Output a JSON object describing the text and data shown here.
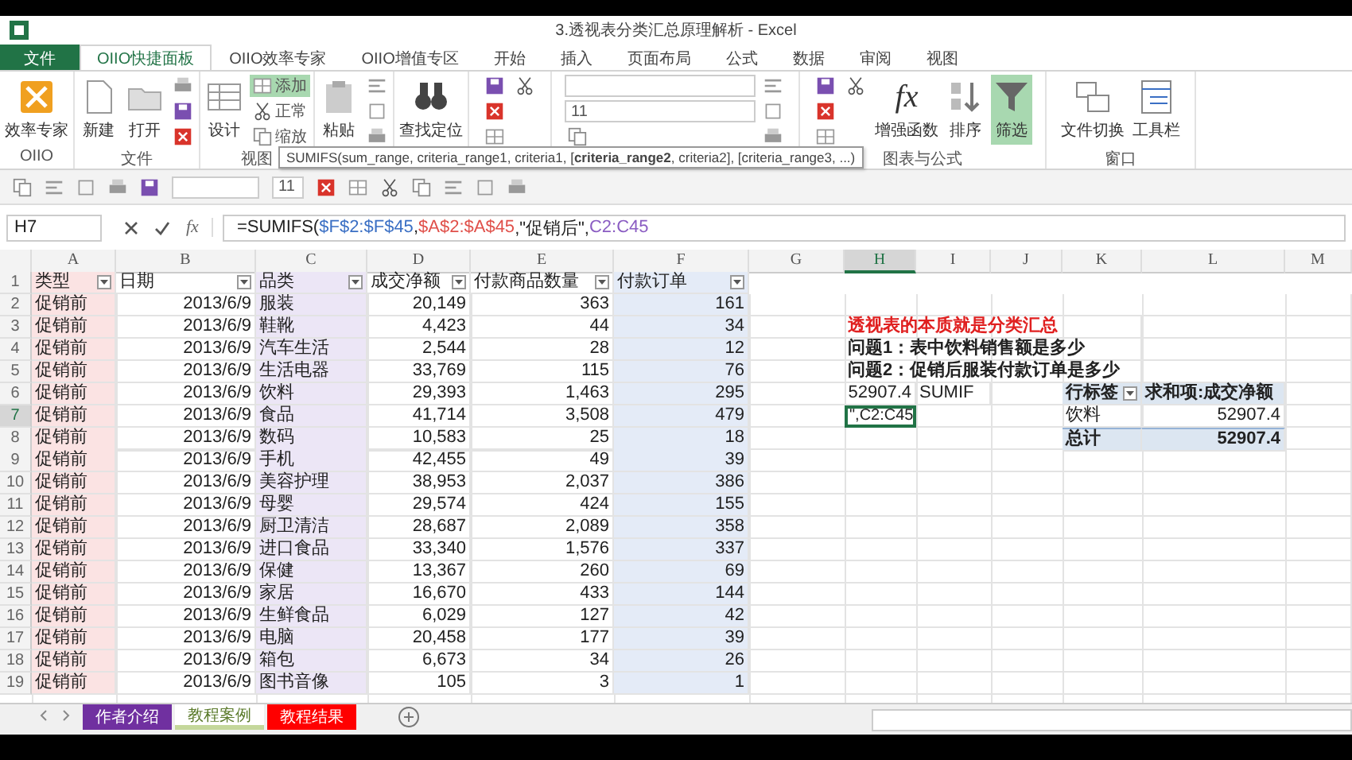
{
  "window": {
    "title": "3.透视表分类汇总原理解析 - Excel"
  },
  "ribbon_tabs": [
    {
      "label": "文件",
      "kind": "file",
      "selected": false
    },
    {
      "label": "OIIO快捷面板",
      "kind": "tab",
      "selected": true
    },
    {
      "label": "OIIO效率专家",
      "kind": "tab",
      "selected": false
    },
    {
      "label": "OIIO增值专区",
      "kind": "tab",
      "selected": false
    },
    {
      "label": "开始",
      "kind": "tab",
      "selected": false
    },
    {
      "label": "插入",
      "kind": "tab",
      "selected": false
    },
    {
      "label": "页面布局",
      "kind": "tab",
      "selected": false
    },
    {
      "label": "公式",
      "kind": "tab",
      "selected": false
    },
    {
      "label": "数据",
      "kind": "tab",
      "selected": false
    },
    {
      "label": "审阅",
      "kind": "tab",
      "selected": false
    },
    {
      "label": "视图",
      "kind": "tab",
      "selected": false
    }
  ],
  "ribbon_groups": [
    {
      "label": "OIIO",
      "items": [
        {
          "kind": "large",
          "label": "效率专家",
          "selected": false
        }
      ]
    },
    {
      "label": "文件",
      "items": [
        {
          "kind": "large",
          "label": "新建",
          "selected": false
        },
        {
          "kind": "large",
          "label": "打开",
          "selected": false
        },
        {
          "kind": "small",
          "selected": false
        },
        {
          "kind": "small",
          "selected": false
        },
        {
          "kind": "small",
          "selected": false
        }
      ]
    },
    {
      "label": "视图",
      "items": [
        {
          "kind": "large",
          "label": "设计",
          "selected": false
        },
        {
          "kind": "small",
          "label": "添加",
          "selected": true
        },
        {
          "kind": "small",
          "label": "正常",
          "selected": false
        },
        {
          "kind": "small",
          "label": "缩放",
          "selected": false
        }
      ]
    },
    {
      "items": [
        {
          "kind": "large",
          "label": "粘贴",
          "selected": false
        },
        {
          "kind": "small",
          "selected": false
        },
        {
          "kind": "small",
          "selected": false
        },
        {
          "kind": "small",
          "selected": false
        }
      ]
    },
    {
      "items": [
        {
          "kind": "large",
          "label": "查找定位",
          "selected": false
        }
      ]
    },
    {
      "items": [
        {
          "kind": "small",
          "selected": false
        },
        {
          "kind": "small",
          "selected": false
        },
        {
          "kind": "small",
          "selected": false
        },
        {
          "kind": "small",
          "selected": false
        }
      ]
    },
    {
      "items": [
        {
          "kind": "field"
        },
        {
          "kind": "field",
          "value": "11"
        },
        {
          "kind": "small",
          "selected": false
        },
        {
          "kind": "small",
          "selected": false
        },
        {
          "kind": "small",
          "selected": false
        },
        {
          "kind": "small",
          "selected": false
        }
      ]
    },
    {
      "label": "图表与公式",
      "items": [
        {
          "kind": "small",
          "selected": false
        },
        {
          "kind": "small",
          "selected": false
        },
        {
          "kind": "small",
          "selected": false
        },
        {
          "kind": "small",
          "selected": false
        },
        {
          "kind": "large",
          "label": "增强函数",
          "glyph": "fx",
          "selected": false
        },
        {
          "kind": "large",
          "label": "排序",
          "selected": false
        },
        {
          "kind": "large",
          "label": "筛选",
          "selected": true
        }
      ]
    },
    {
      "label": "窗口",
      "items": [
        {
          "kind": "large",
          "label": "文件切换",
          "selected": false
        },
        {
          "kind": "large",
          "label": "工具栏",
          "selected": false
        }
      ]
    }
  ],
  "tooltip": "SUMIFS(sum_range, criteria_range1, criteria1, [**criteria_range2**, criteria2], [criteria_range3, ...)",
  "quick_access": [
    {
      "kind": "icon"
    },
    {
      "kind": "icon"
    },
    {
      "kind": "icon"
    },
    {
      "kind": "icon"
    },
    {
      "kind": "icon"
    },
    {
      "kind": "field"
    },
    {
      "kind": "field",
      "value": "11"
    },
    {
      "kind": "icon"
    },
    {
      "kind": "icon"
    },
    {
      "kind": "icon"
    },
    {
      "kind": "icon"
    },
    {
      "kind": "icon"
    },
    {
      "kind": "icon"
    },
    {
      "kind": "icon"
    }
  ],
  "formula_bar": {
    "name_box": "H7",
    "fx": "fx",
    "parts": [
      {
        "text": "=SUMIFS(",
        "color": "#222222"
      },
      {
        "text": "$F$2:$F$45",
        "color": "#3a6fc4"
      },
      {
        "text": ",",
        "color": "#222222"
      },
      {
        "text": "$A$2:$A$45",
        "color": "#e0504a"
      },
      {
        "text": ",\"促销后\",",
        "color": "#222222"
      },
      {
        "text": "C2:C45",
        "color": "#8a5cc2"
      }
    ]
  },
  "sheet": {
    "columns": [
      {
        "letter": "A",
        "selected": false,
        "color": "#fbe3e3"
      },
      {
        "letter": "B",
        "selected": false
      },
      {
        "letter": "C",
        "selected": false,
        "color": "#ece6f6"
      },
      {
        "letter": "D",
        "selected": false
      },
      {
        "letter": "E",
        "selected": false
      },
      {
        "letter": "F",
        "selected": false,
        "color": "#e4ebf7"
      },
      {
        "letter": "G",
        "selected": false
      },
      {
        "letter": "H",
        "selected": true
      },
      {
        "letter": "I",
        "selected": false
      },
      {
        "letter": "J",
        "selected": false
      },
      {
        "letter": "K",
        "selected": false
      },
      {
        "letter": "L",
        "selected": false
      },
      {
        "letter": "M",
        "selected": false
      }
    ],
    "header_row": {
      "number": "1",
      "cells": [
        "类型",
        "日期",
        "品类",
        "成交净额",
        "付款商品数量",
        "付款订单"
      ]
    },
    "rows": [
      {
        "number": "2",
        "selected": false,
        "cells": [
          "促销前",
          "2013/6/9",
          "服装",
          "20,149",
          "363",
          "161"
        ]
      },
      {
        "number": "3",
        "selected": false,
        "cells": [
          "促销前",
          "2013/6/9",
          "鞋靴",
          "4,423",
          "44",
          "34"
        ]
      },
      {
        "number": "4",
        "selected": false,
        "cells": [
          "促销前",
          "2013/6/9",
          "汽车生活",
          "2,544",
          "28",
          "12"
        ]
      },
      {
        "number": "5",
        "selected": false,
        "cells": [
          "促销前",
          "2013/6/9",
          "生活电器",
          "33,769",
          "115",
          "76"
        ]
      },
      {
        "number": "6",
        "selected": false,
        "cells": [
          "促销前",
          "2013/6/9",
          "饮料",
          "29,393",
          "1,463",
          "295"
        ]
      },
      {
        "number": "7",
        "selected": true,
        "cells": [
          "促销前",
          "2013/6/9",
          "食品",
          "41,714",
          "3,508",
          "479"
        ]
      },
      {
        "number": "8",
        "selected": false,
        "cells": [
          "促销前",
          "2013/6/9",
          "数码",
          "10,583",
          "25",
          "18"
        ]
      },
      {
        "number": "9",
        "selected": false,
        "cells": [
          "促销前",
          "2013/6/9",
          "手机",
          "42,455",
          "49",
          "39"
        ]
      },
      {
        "number": "10",
        "selected": false,
        "cells": [
          "促销前",
          "2013/6/9",
          "美容护理",
          "38,953",
          "2,037",
          "386"
        ]
      },
      {
        "number": "11",
        "selected": false,
        "cells": [
          "促销前",
          "2013/6/9",
          "母婴",
          "29,574",
          "424",
          "155"
        ]
      },
      {
        "number": "12",
        "selected": false,
        "cells": [
          "促销前",
          "2013/6/9",
          "厨卫清洁",
          "28,687",
          "2,089",
          "358"
        ]
      },
      {
        "number": "13",
        "selected": false,
        "cells": [
          "促销前",
          "2013/6/9",
          "进口食品",
          "33,340",
          "1,576",
          "337"
        ]
      },
      {
        "number": "14",
        "selected": false,
        "cells": [
          "促销前",
          "2013/6/9",
          "保健",
          "13,367",
          "260",
          "69"
        ]
      },
      {
        "number": "15",
        "selected": false,
        "cells": [
          "促销前",
          "2013/6/9",
          "家居",
          "16,670",
          "433",
          "144"
        ]
      },
      {
        "number": "16",
        "selected": false,
        "cells": [
          "促销前",
          "2013/6/9",
          "生鲜食品",
          "6,029",
          "127",
          "42"
        ]
      },
      {
        "number": "17",
        "selected": false,
        "cells": [
          "促销前",
          "2013/6/9",
          "电脑",
          "20,458",
          "177",
          "39"
        ]
      },
      {
        "number": "18",
        "selected": false,
        "cells": [
          "促销前",
          "2013/6/9",
          "箱包",
          "6,673",
          "34",
          "26"
        ]
      },
      {
        "number": "19",
        "selected": false,
        "cells": [
          "促销前",
          "2013/6/9",
          "图书音像",
          "105",
          "3",
          "1"
        ]
      }
    ],
    "notes": [
      {
        "text": "透视表的本质就是分类汇总",
        "kind": "title"
      },
      {
        "text": "问题1：表中饮料销售额是多少",
        "kind": "question"
      },
      {
        "text": "问题2：促销后服装付款订单是多少",
        "kind": "question"
      }
    ],
    "sumif": {
      "value": "52907.4",
      "label": "SUMIF"
    },
    "active_cell": "\",C2:C45",
    "pivot": {
      "headers": [
        "行标签",
        "求和项:成交净额"
      ],
      "rows": [
        {
          "label": "饮料",
          "value": "52907.4",
          "kind": "item"
        },
        {
          "label": "总计",
          "value": "52907.4",
          "kind": "total"
        }
      ]
    }
  },
  "sheet_tabs": [
    {
      "label": "作者介绍",
      "color": "#7030a0",
      "selected": false
    },
    {
      "label": "教程案例",
      "color": "#c4d79b",
      "selected": true
    },
    {
      "label": "教程结果",
      "color": "#ff0000",
      "selected": false
    }
  ]
}
